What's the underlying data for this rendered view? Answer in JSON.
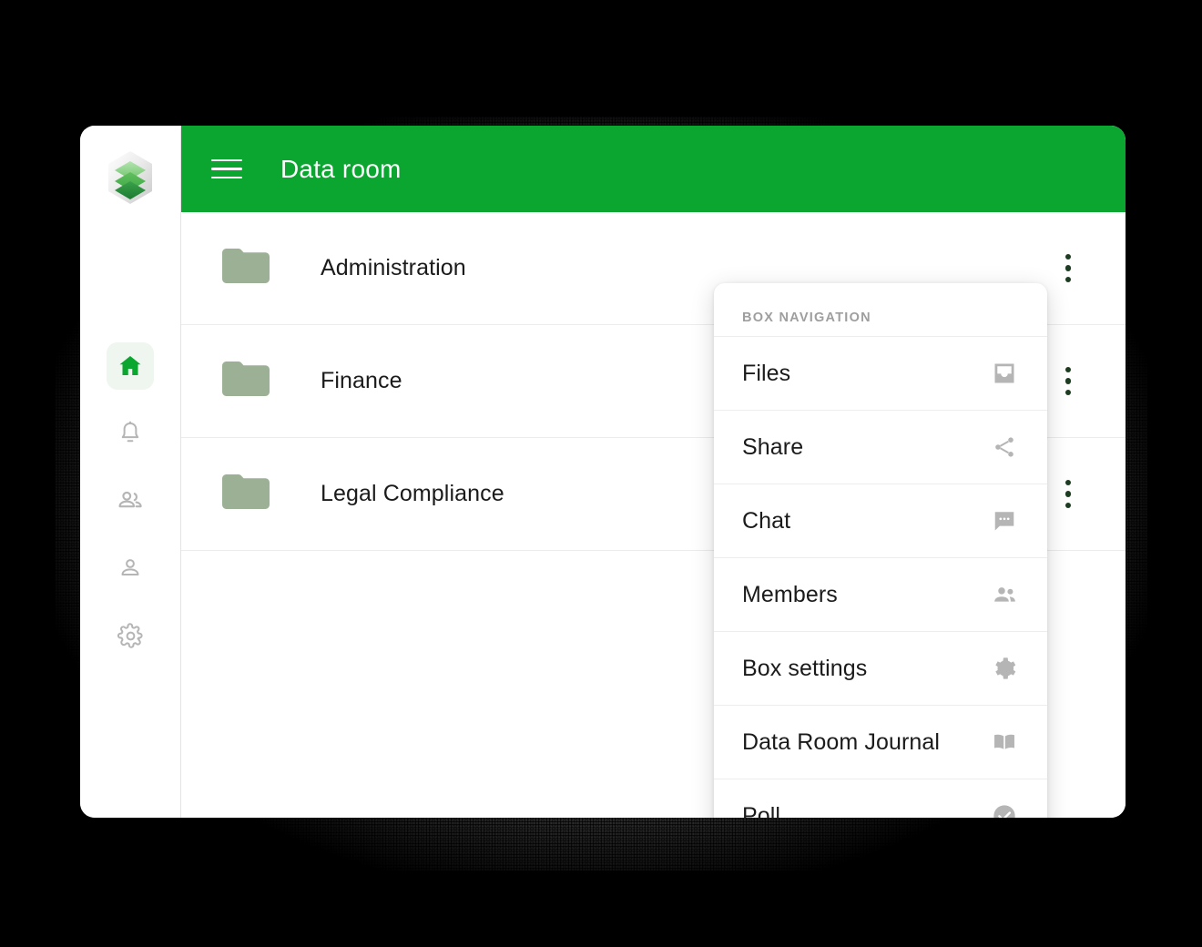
{
  "window": {
    "title": "Data room"
  },
  "colors": {
    "brand_green": "#0aa630",
    "header_green": "#0aa630",
    "folder_sage": "#9cb096",
    "menu_icon_gray": "#b5b5b5",
    "active_rail_bg": "#eff5ef",
    "row_divider": "#ececec",
    "text_dark": "#1b1b1b",
    "muted_label": "#9e9e9e",
    "dots_dark_green": "#1d3c21",
    "page_background": "#000000"
  },
  "topbar": {
    "menu_icon": "hamburger-icon",
    "title": "Data room"
  },
  "rail": {
    "logo_icon": "stacked-layers-logo",
    "items": [
      {
        "id": "home",
        "icon": "home-icon",
        "label": "Home",
        "active": true
      },
      {
        "id": "notifications",
        "icon": "bell-icon",
        "label": "Notifications",
        "active": false
      },
      {
        "id": "contacts",
        "icon": "people-group-icon",
        "label": "Contacts",
        "active": false
      },
      {
        "id": "profile",
        "icon": "person-icon",
        "label": "Profile",
        "active": false
      },
      {
        "id": "settings",
        "icon": "gear-icon",
        "label": "Settings",
        "active": false
      }
    ]
  },
  "folders": [
    {
      "name": "Administration",
      "icon": "folder-icon",
      "menu_icon": "more-vertical-icon"
    },
    {
      "name": "Finance",
      "icon": "folder-icon",
      "menu_icon": "more-vertical-icon"
    },
    {
      "name": "Legal Compliance",
      "icon": "folder-icon",
      "menu_icon": "more-vertical-icon"
    }
  ],
  "box_navigation": {
    "heading": "BOX NAVIGATION",
    "items": [
      {
        "label": "Files",
        "icon": "inbox-tray-icon"
      },
      {
        "label": "Share",
        "icon": "share-nodes-icon"
      },
      {
        "label": "Chat",
        "icon": "chat-bubble-icon"
      },
      {
        "label": "Members",
        "icon": "people-group-icon"
      },
      {
        "label": "Box settings",
        "icon": "gear-icon"
      },
      {
        "label": "Data Room Journal",
        "icon": "open-book-icon"
      },
      {
        "label": "Poll",
        "icon": "check-circle-icon"
      }
    ]
  }
}
